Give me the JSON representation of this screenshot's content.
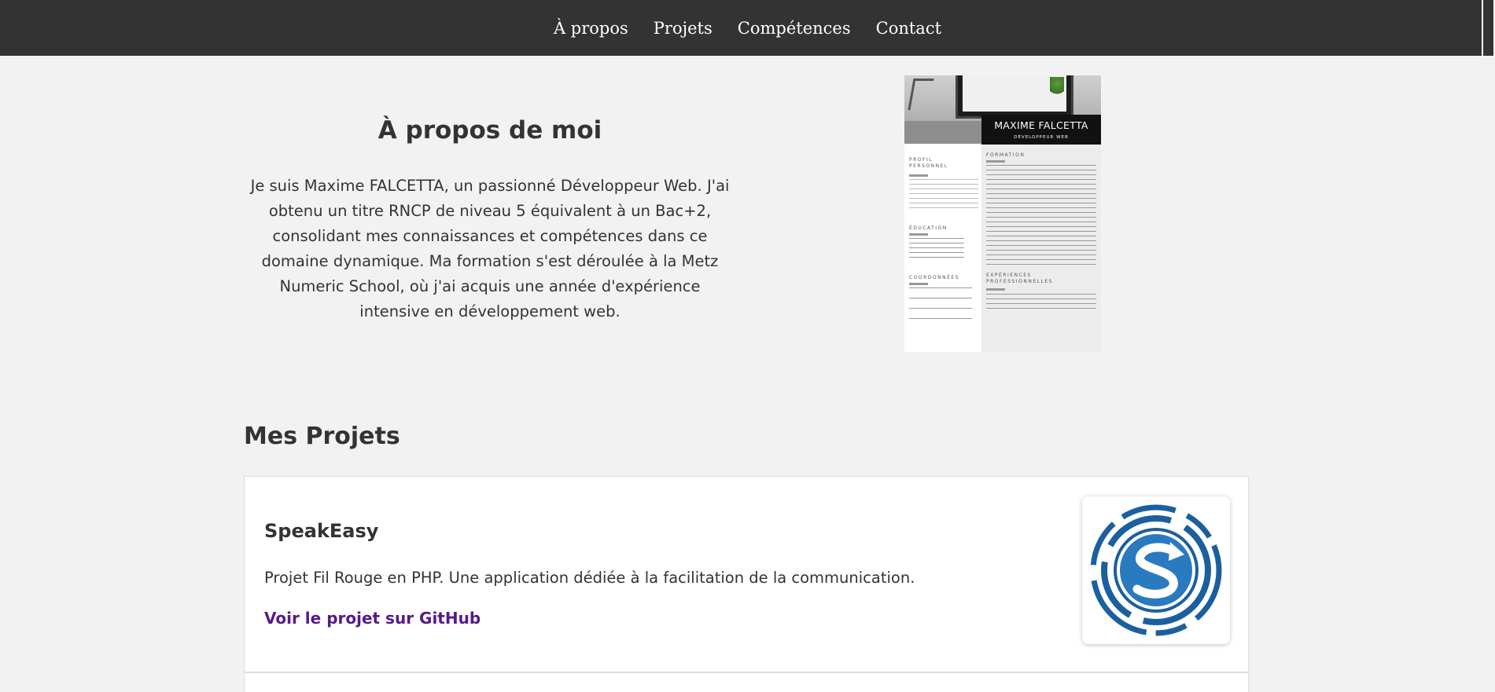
{
  "nav": {
    "items": [
      {
        "label": "À propos"
      },
      {
        "label": "Projets"
      },
      {
        "label": "Compétences"
      },
      {
        "label": "Contact"
      }
    ]
  },
  "about": {
    "title": "À propos de moi",
    "text": "Je suis Maxime FALCETTA, un passionné Développeur Web. J'ai obtenu un titre RNCP de niveau 5 équivalent à un Bac+2, consolidant mes connaissances et compétences dans ce domaine dynamique. Ma formation s'est déroulée à la Metz Numeric School, où j'ai acquis une année d'expérience intensive en développement web."
  },
  "cv": {
    "name": "MAXIME FALCETTA",
    "role": "DÉVELOPPEUR WEB",
    "left_sections": [
      "PROFIL PERSONNEL",
      "ÉDUCATION",
      "COORDONNÉES"
    ],
    "right_sections": [
      "FORMATION",
      "EXPÉRIENCES PROFESSIONNELLES"
    ]
  },
  "projects": {
    "title": "Mes Projets",
    "items": [
      {
        "title": "SpeakEasy",
        "description": "Projet Fil Rouge en PHP. Une application dédiée à la facilitation de la communication.",
        "link_label": "Voir le projet sur GitHub"
      }
    ]
  },
  "colors": {
    "nav_bg": "#333333",
    "page_bg": "#f2f2f2",
    "link_visited": "#551a8b",
    "logo_blue": "#1b5f9e"
  }
}
